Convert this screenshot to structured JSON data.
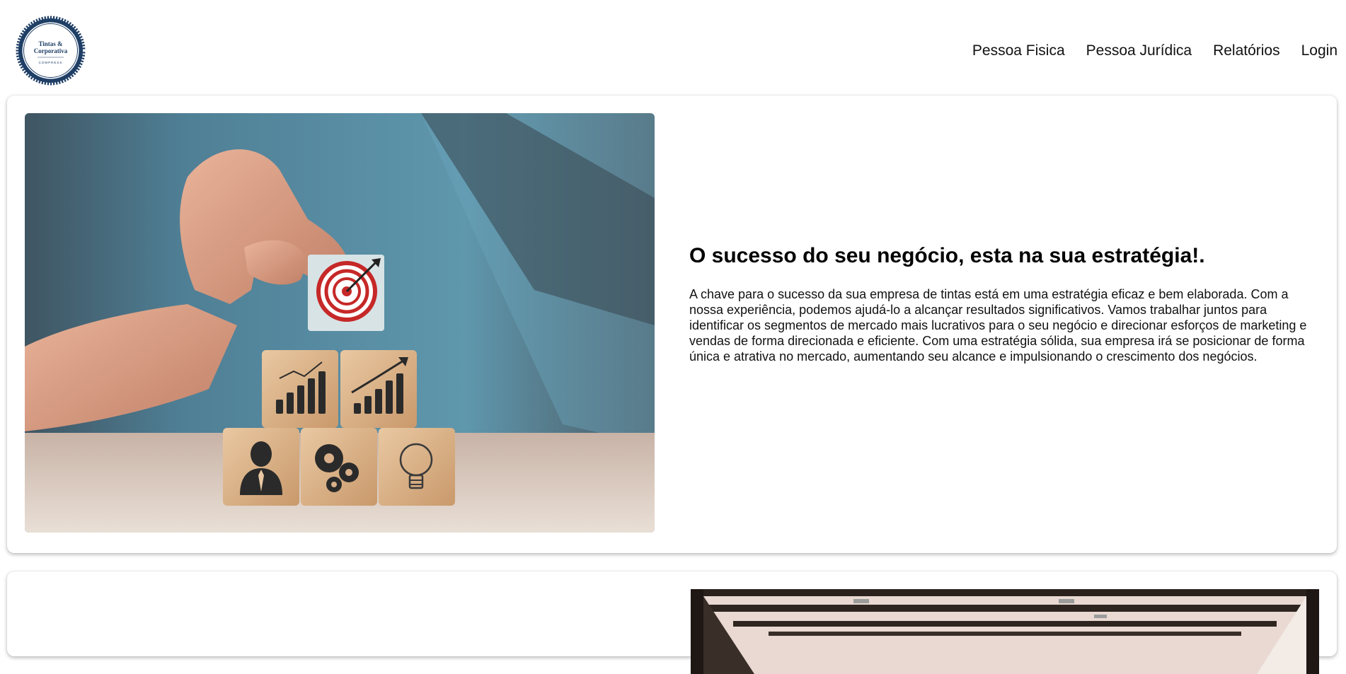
{
  "logo": {
    "line1": "Tintas &",
    "line2": "Corporativa",
    "small": "COMPRESS",
    "ring_color": "#1f3f66"
  },
  "nav": {
    "items": [
      {
        "label": "Pessoa Fisica"
      },
      {
        "label": "Pessoa Jurídica"
      },
      {
        "label": "Relatórios"
      },
      {
        "label": "Login"
      }
    ]
  },
  "hero": {
    "image_icon": "strategy-blocks-photo",
    "headline": "O sucesso do seu negócio, esta na sua estratégia!.",
    "paragraph": "A chave para o sucesso da sua empresa de tintas está em uma estratégia eficaz e bem elaborada. Com a nossa experiência, podemos ajudá-lo a alcançar resultados significativos. Vamos trabalhar juntos para identificar os segmentos de mercado mais lucrativos para o seu negócio e direcionar esforços de marketing e vendas de forma direcionada e eficiente. Com uma estratégia sólida, sua empresa irá se posicionar de forma única e atrativa no mercado, aumentando seu alcance e impulsionando o crescimento dos negócios."
  },
  "second_section": {
    "image_icon": "office-ceiling-photo"
  }
}
